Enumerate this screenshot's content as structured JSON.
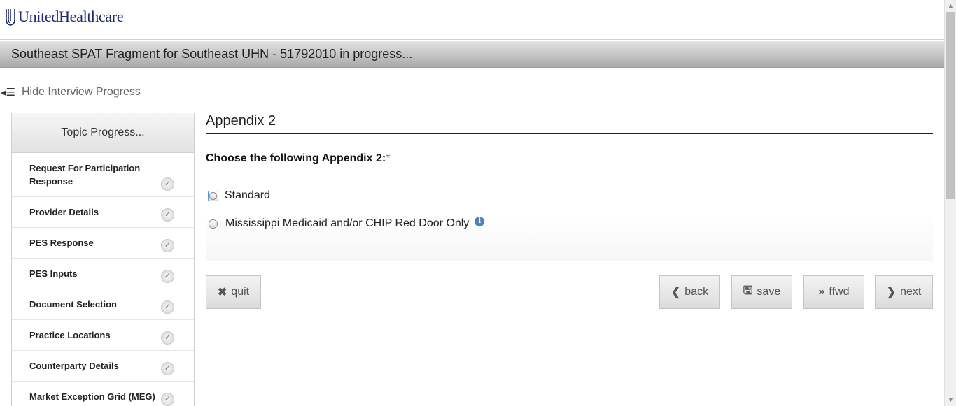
{
  "brand": {
    "name": "UnitedHealthcare"
  },
  "header": {
    "title": "Southeast SPAT Fragment for Southeast UHN - 51792010 in progress..."
  },
  "progress_toggle": {
    "label": "Hide Interview Progress",
    "icon": "list-collapse-icon"
  },
  "sidebar": {
    "heading": "Topic Progress...",
    "items": [
      {
        "label": "Request For Participation Response",
        "status_icon": "check-icon"
      },
      {
        "label": "Provider Details",
        "status_icon": "check-icon"
      },
      {
        "label": "PES Response",
        "status_icon": "check-icon"
      },
      {
        "label": "PES Inputs",
        "status_icon": "check-icon"
      },
      {
        "label": "Document Selection",
        "status_icon": "check-icon"
      },
      {
        "label": "Practice Locations",
        "status_icon": "check-icon"
      },
      {
        "label": "Counterparty Details",
        "status_icon": "check-icon"
      },
      {
        "label": "Market Exception Grid (MEG)",
        "status_icon": "check-icon"
      }
    ]
  },
  "main": {
    "section_title": "Appendix 2",
    "question": "Choose the following Appendix 2:",
    "required_marker": "*",
    "options": [
      {
        "label": "Standard",
        "selected": false
      },
      {
        "label": "Mississippi Medicaid and/or CHIP Red Door Only",
        "selected": false,
        "info": "i"
      }
    ]
  },
  "buttons": {
    "quit": "quit",
    "back": "back",
    "save": "save",
    "ffwd": "ffwd",
    "next": "next"
  },
  "colors": {
    "brand_blue": "#1c2b6b",
    "required_red": "#d9534f",
    "info_blue": "#4a7fc1"
  }
}
